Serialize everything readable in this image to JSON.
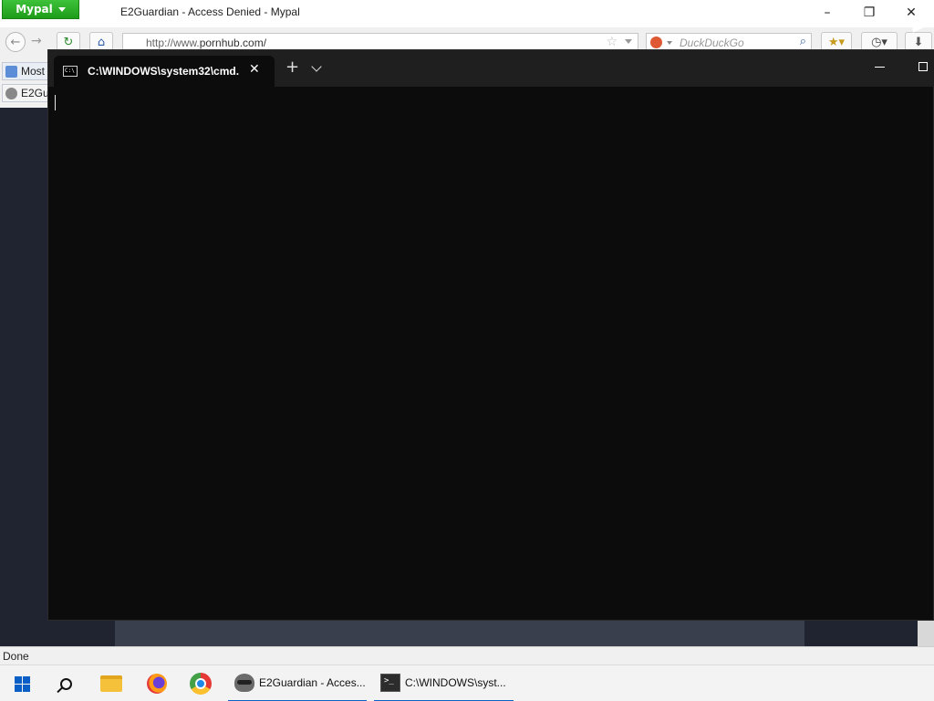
{
  "browser": {
    "app_button": "Mypal",
    "window_title": "E2Guardian - Access Denied - Mypal",
    "url_prefix": "http://www.",
    "url_domain": "pornhub.com/",
    "search_placeholder": "DuckDuckGo",
    "bookmarks": [
      "Most",
      "E2Gua"
    ],
    "status": "Done"
  },
  "terminal": {
    "tab_title": "C:\\WINDOWS\\system32\\cmd.",
    "new_tab": "+"
  },
  "taskbar": {
    "apps": [
      {
        "label": "E2Guardian - Acces..."
      },
      {
        "label": "C:\\WINDOWS\\syst..."
      }
    ]
  },
  "colors": {
    "accent": "#0a64c8",
    "terminal_bg": "#0c0c0c",
    "mypal_green": "#2aae26"
  }
}
